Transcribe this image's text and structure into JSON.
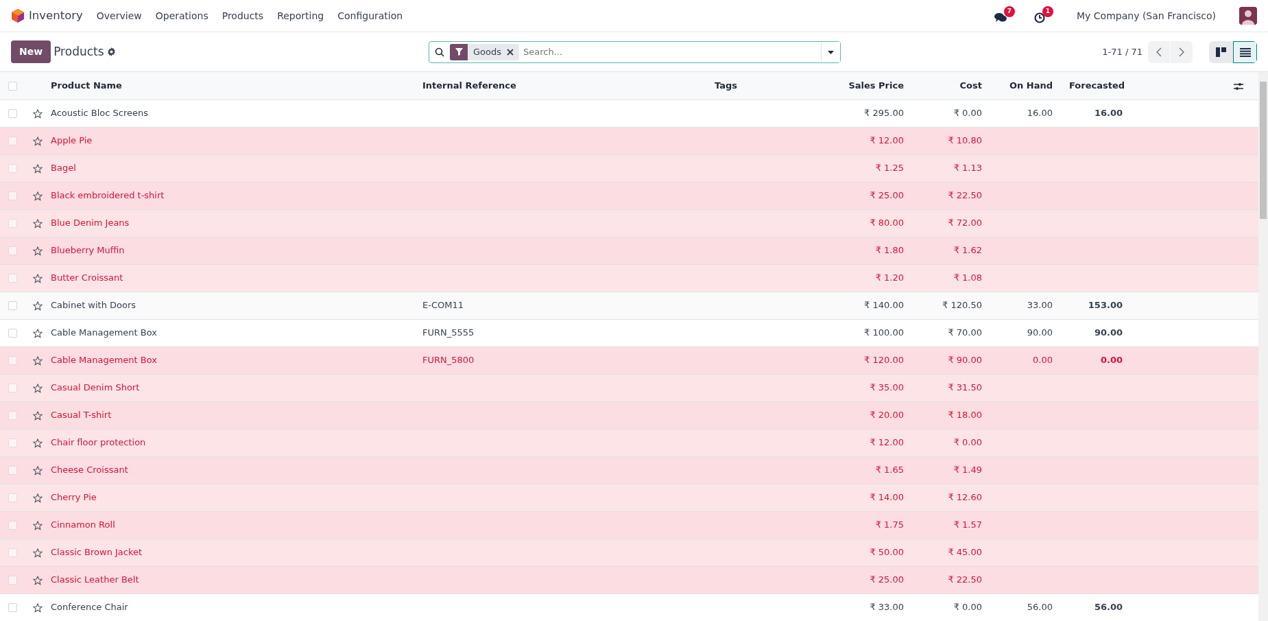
{
  "navbar": {
    "app": "Inventory",
    "menu": [
      "Overview",
      "Operations",
      "Products",
      "Reporting",
      "Configuration"
    ],
    "messages_count": "7",
    "activities_count": "1",
    "company": "My Company (San Francisco)"
  },
  "control_panel": {
    "new_button": "New",
    "title": "Products",
    "filter_facet": "Goods",
    "search_placeholder": "Search...",
    "pager": "1-71 / 71",
    "views": [
      {
        "kind": "kanban",
        "selected": false
      },
      {
        "kind": "list",
        "selected": true
      }
    ]
  },
  "table": {
    "select_all_checked": false,
    "columns": [
      "Product Name",
      "Internal Reference",
      "Tags",
      "Sales Price",
      "Cost",
      "On Hand",
      "Forecasted"
    ],
    "rows": [
      {
        "name": "Acoustic Bloc Screens",
        "reference": "",
        "sales_price": "₹ 295.00",
        "cost": "₹ 0.00",
        "on_hand": "16.00",
        "forecasted": "16.00",
        "alert": false,
        "checked": false
      },
      {
        "name": "Apple Pie",
        "reference": "",
        "sales_price": "₹ 12.00",
        "cost": "₹ 10.80",
        "on_hand": "",
        "forecasted": "",
        "alert": true,
        "checked": false
      },
      {
        "name": "Bagel",
        "reference": "",
        "sales_price": "₹ 1.25",
        "cost": "₹ 1.13",
        "on_hand": "",
        "forecasted": "",
        "alert": true,
        "checked": false
      },
      {
        "name": "Black embroidered t-shirt",
        "reference": "",
        "sales_price": "₹ 25.00",
        "cost": "₹ 22.50",
        "on_hand": "",
        "forecasted": "",
        "alert": true,
        "checked": false
      },
      {
        "name": "Blue Denim Jeans",
        "reference": "",
        "sales_price": "₹ 80.00",
        "cost": "₹ 72.00",
        "on_hand": "",
        "forecasted": "",
        "alert": true,
        "checked": false
      },
      {
        "name": "Blueberry Muffin",
        "reference": "",
        "sales_price": "₹ 1.80",
        "cost": "₹ 1.62",
        "on_hand": "",
        "forecasted": "",
        "alert": true,
        "checked": false
      },
      {
        "name": "Butter Croissant",
        "reference": "",
        "sales_price": "₹ 1.20",
        "cost": "₹ 1.08",
        "on_hand": "",
        "forecasted": "",
        "alert": true,
        "checked": false
      },
      {
        "name": "Cabinet with Doors",
        "reference": "E-COM11",
        "sales_price": "₹ 140.00",
        "cost": "₹ 120.50",
        "on_hand": "33.00",
        "forecasted": "153.00",
        "alert": false,
        "checked": false
      },
      {
        "name": "Cable Management Box",
        "reference": "FURN_5555",
        "sales_price": "₹ 100.00",
        "cost": "₹ 70.00",
        "on_hand": "90.00",
        "forecasted": "90.00",
        "alert": false,
        "checked": false
      },
      {
        "name": "Cable Management Box",
        "reference": "FURN_5800",
        "sales_price": "₹ 120.00",
        "cost": "₹ 90.00",
        "on_hand": "0.00",
        "forecasted": "0.00",
        "alert": true,
        "checked": false
      },
      {
        "name": "Casual Denim Short",
        "reference": "",
        "sales_price": "₹ 35.00",
        "cost": "₹ 31.50",
        "on_hand": "",
        "forecasted": "",
        "alert": true,
        "checked": false
      },
      {
        "name": "Casual T-shirt",
        "reference": "",
        "sales_price": "₹ 20.00",
        "cost": "₹ 18.00",
        "on_hand": "",
        "forecasted": "",
        "alert": true,
        "checked": false
      },
      {
        "name": "Chair floor protection",
        "reference": "",
        "sales_price": "₹ 12.00",
        "cost": "₹ 0.00",
        "on_hand": "",
        "forecasted": "",
        "alert": true,
        "checked": false
      },
      {
        "name": "Cheese Croissant",
        "reference": "",
        "sales_price": "₹ 1.65",
        "cost": "₹ 1.49",
        "on_hand": "",
        "forecasted": "",
        "alert": true,
        "checked": false
      },
      {
        "name": "Cherry Pie",
        "reference": "",
        "sales_price": "₹ 14.00",
        "cost": "₹ 12.60",
        "on_hand": "",
        "forecasted": "",
        "alert": true,
        "checked": false
      },
      {
        "name": "Cinnamon Roll",
        "reference": "",
        "sales_price": "₹ 1.75",
        "cost": "₹ 1.57",
        "on_hand": "",
        "forecasted": "",
        "alert": true,
        "checked": false
      },
      {
        "name": "Classic Brown Jacket",
        "reference": "",
        "sales_price": "₹ 50.00",
        "cost": "₹ 45.00",
        "on_hand": "",
        "forecasted": "",
        "alert": true,
        "checked": false
      },
      {
        "name": "Classic Leather Belt",
        "reference": "",
        "sales_price": "₹ 25.00",
        "cost": "₹ 22.50",
        "on_hand": "",
        "forecasted": "",
        "alert": true,
        "checked": false
      },
      {
        "name": "Conference Chair",
        "reference": "",
        "sales_price": "₹ 33.00",
        "cost": "₹ 0.00",
        "on_hand": "56.00",
        "forecasted": "56.00",
        "alert": false,
        "checked": false
      }
    ]
  }
}
